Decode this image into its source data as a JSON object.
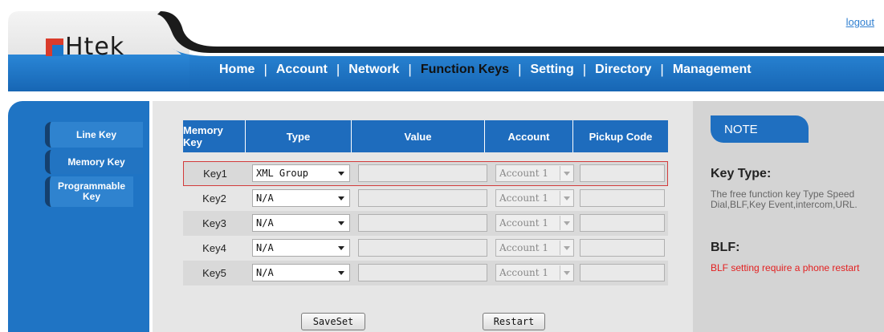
{
  "header": {
    "logout": "logout",
    "logo_text": "Htek",
    "nav": [
      {
        "label": "Home"
      },
      {
        "label": "Account"
      },
      {
        "label": "Network"
      },
      {
        "label": "Function Keys",
        "active": true
      },
      {
        "label": "Setting"
      },
      {
        "label": "Directory"
      },
      {
        "label": "Management"
      }
    ],
    "nav_separator": "|"
  },
  "sidebar": {
    "items": [
      {
        "label": "Line Key"
      },
      {
        "label": "Memory Key",
        "active": true
      },
      {
        "label": "Programmable Key"
      }
    ]
  },
  "table": {
    "columns": [
      "Memory Key",
      "Type",
      "Value",
      "Account",
      "Pickup Code"
    ],
    "rows": [
      {
        "key": "Key1",
        "type": "XML Group",
        "value": "",
        "account": "Account 1",
        "pickup": ""
      },
      {
        "key": "Key2",
        "type": "N/A",
        "value": "",
        "account": "Account 1",
        "pickup": ""
      },
      {
        "key": "Key3",
        "type": "N/A",
        "value": "",
        "account": "Account 1",
        "pickup": ""
      },
      {
        "key": "Key4",
        "type": "N/A",
        "value": "",
        "account": "Account 1",
        "pickup": ""
      },
      {
        "key": "Key5",
        "type": "N/A",
        "value": "",
        "account": "Account 1",
        "pickup": ""
      }
    ]
  },
  "buttons": {
    "save": "SaveSet",
    "restart": "Restart"
  },
  "note": {
    "tab": "NOTE",
    "key_type_title": "Key Type:",
    "key_type_text": "The free function key Type Speed Dial,BLF,Key Event,intercom,URL.",
    "blf_title": "BLF:",
    "blf_text": "BLF setting require a phone restart"
  },
  "colors": {
    "brand_blue": "#1f74c4",
    "nav_bar": "#1a70c4",
    "highlight_border": "#d33b3b",
    "warning_text": "#e32020"
  }
}
